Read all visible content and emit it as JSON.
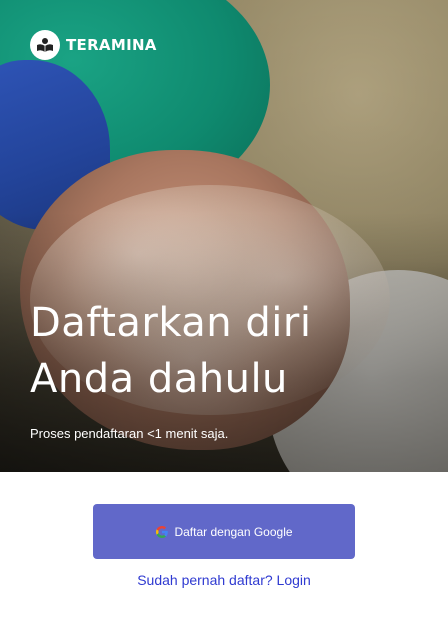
{
  "brand": {
    "name": "TERAMINA",
    "logo_icon": "book-reader-icon"
  },
  "hero": {
    "title_line_1": "Daftarkan diri",
    "title_line_2": "Anda dahulu",
    "subtitle": "Proses pendaftaran <1 menit saja."
  },
  "actions": {
    "google_signup_label": "Daftar dengan Google",
    "google_icon": "google-g-icon",
    "login_prompt": "Sudah pernah daftar? Login"
  },
  "colors": {
    "primary_button": "#6168c9",
    "link": "#2f3ad1",
    "hero_text": "#ffffff"
  }
}
